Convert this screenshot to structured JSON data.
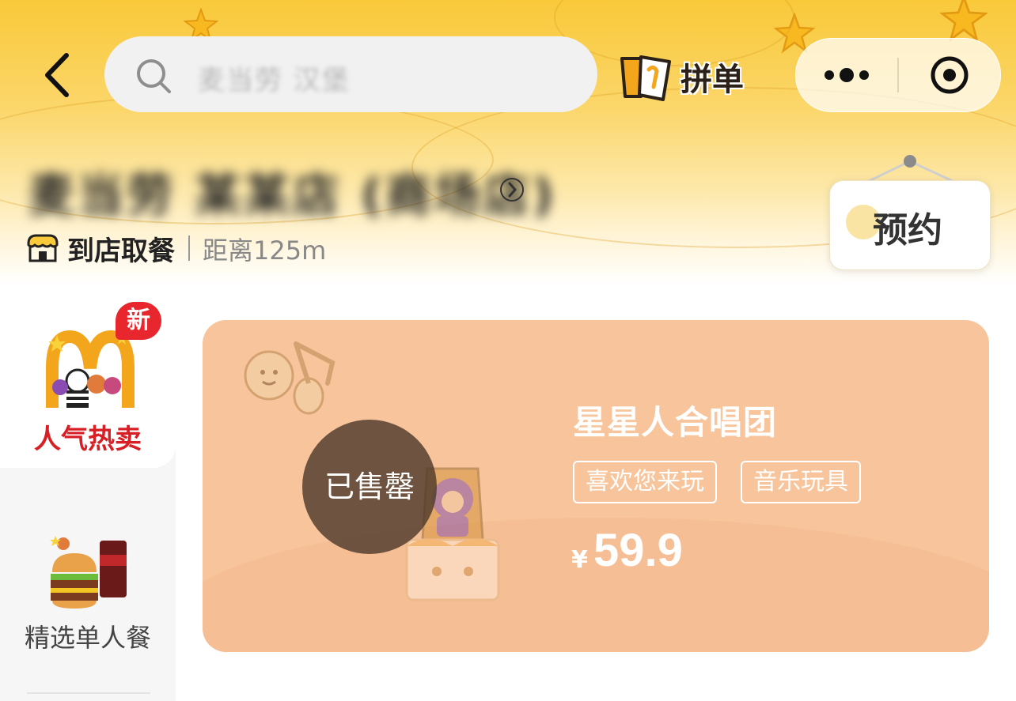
{
  "header": {
    "search_placeholder": "麦当劳 汉堡",
    "pin_label": "拼单",
    "back_icon": "chevron-left-icon",
    "more_icon": "more-dots-icon",
    "close_icon": "target-circle-icon"
  },
  "store": {
    "name": "麦当劳 某某店 (商场店)",
    "mode": "到店取餐",
    "distance": "距离125m",
    "reserve_label": "预约"
  },
  "sidebar": {
    "items": [
      {
        "label": "人气热卖",
        "badge": "新",
        "active": true,
        "icon": "mcdonalds-arches-icon"
      },
      {
        "label": "精选单人餐",
        "active": false,
        "icon": "burger-meal-icon"
      }
    ]
  },
  "product": {
    "title": "星星人合唱团",
    "tags": [
      "喜欢您来玩",
      "音乐玩具"
    ],
    "currency": "¥",
    "price": "59.9",
    "status": "已售罄"
  },
  "colors": {
    "brand_yellow": "#f9c93a",
    "accent_red": "#d81f26",
    "card_bg": "#f7c49b"
  }
}
